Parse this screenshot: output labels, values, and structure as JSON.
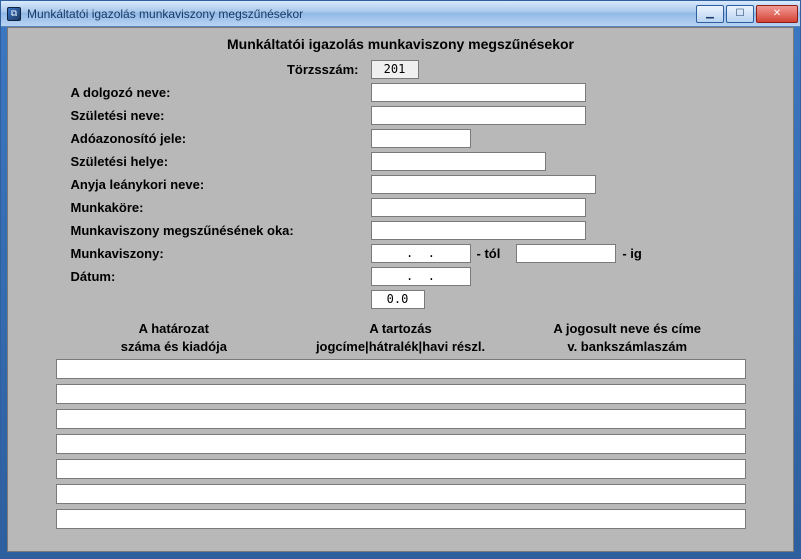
{
  "window": {
    "title": "Munkáltatói igazolás munkaviszony megszűnésekor"
  },
  "page": {
    "title": "Munkáltatói igazolás munkaviszony megszűnésekor"
  },
  "labels": {
    "torzsszam": "Törzsszám:",
    "nev": "A dolgozó neve:",
    "szul_nev": "Születési neve:",
    "ado": "Adóazonosító jele:",
    "szul_hely": "Születési helye:",
    "anyja": "Anyja leánykori neve:",
    "munkakor": "Munkaköre:",
    "ok": "Munkaviszony megszűnésének oka:",
    "mv": "Munkaviszony:",
    "mv_tol": "- tól",
    "mv_ig": "- ig",
    "datum": "Dátum:"
  },
  "values": {
    "torzsszam": "201",
    "nev": "",
    "szul_nev": "",
    "ado": "",
    "szul_hely": "",
    "anyja": "",
    "munkakor": "",
    "ok": "",
    "mv_tol": ".  .",
    "mv_ig": "",
    "datum": ".  .",
    "extra": "0.0"
  },
  "columns": {
    "c1_line1": "A határozat",
    "c1_line2": "száma és kiadója",
    "c2_line1": "A tartozás",
    "c2_line2": "jogcíme|hátralék|havi részl.",
    "c3_line1": "A jogosult neve és címe",
    "c3_line2": "v. bankszámlaszám"
  },
  "lines": [
    "",
    "",
    "",
    "",
    "",
    "",
    ""
  ],
  "icons": {
    "app": "⧉",
    "min": "▁",
    "max": "☐",
    "close": "✕"
  }
}
